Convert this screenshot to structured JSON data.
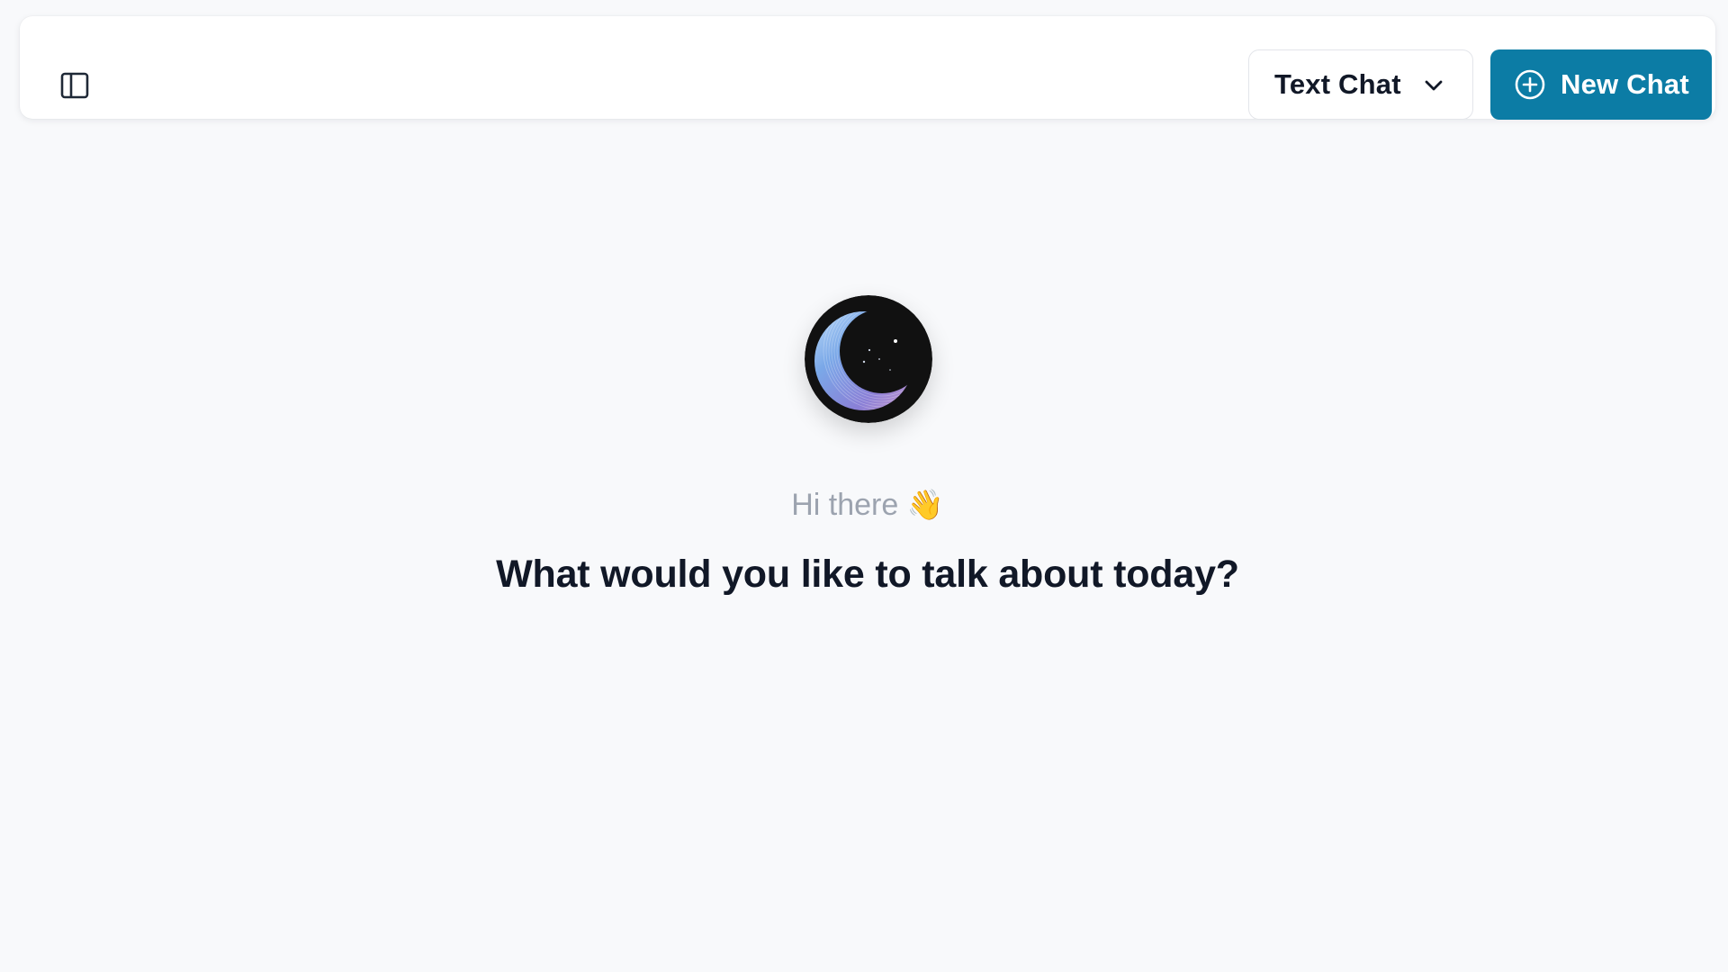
{
  "header": {
    "sidebar_toggle_icon": "sidebar-panel-icon",
    "mode_select": {
      "selected": "Text Chat",
      "icon": "chevron-down-icon"
    },
    "new_chat": {
      "label": "New Chat",
      "icon": "plus-circle-icon",
      "background_color": "#0c7ca5"
    }
  },
  "main": {
    "avatar_icon": "crescent-moon-logo",
    "greeting": "Hi there",
    "greeting_emoji": "👋",
    "headline": "What would you like to talk about today?"
  },
  "colors": {
    "background": "#f8f9fb",
    "accent": "#0c7ca5",
    "text_primary": "#111827",
    "text_muted": "#9ca3af"
  }
}
